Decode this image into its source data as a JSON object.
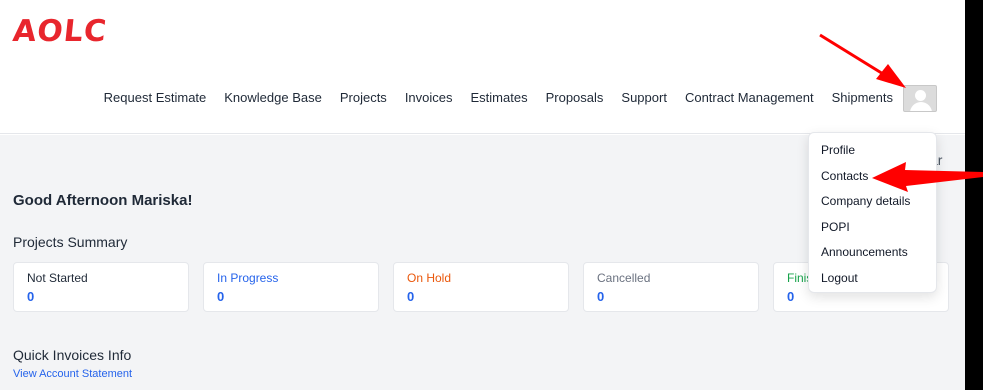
{
  "brand": {
    "logo_text": "AOLC",
    "color": "#e8262d"
  },
  "nav": {
    "items": [
      {
        "label": "Request Estimate"
      },
      {
        "label": "Knowledge Base"
      },
      {
        "label": "Projects"
      },
      {
        "label": "Invoices"
      },
      {
        "label": "Estimates"
      },
      {
        "label": "Proposals"
      },
      {
        "label": "Support"
      },
      {
        "label": "Contract Management"
      },
      {
        "label": "Shipments"
      }
    ],
    "avatar_icon": "user-avatar-icon"
  },
  "main": {
    "greeting": "Good Afternoon Mariska!",
    "partial_right_text": "ar",
    "projects_summary_title": "Projects Summary",
    "cards": [
      {
        "label": "Not Started",
        "value": "0",
        "label_color": "#1f2937"
      },
      {
        "label": "In Progress",
        "value": "0",
        "label_color": "#2563eb"
      },
      {
        "label": "On Hold",
        "value": "0",
        "label_color": "#ea580c"
      },
      {
        "label": "Cancelled",
        "value": "0",
        "label_color": "#6b7280"
      },
      {
        "label": "Finis",
        "value": "0",
        "label_color": "#16a34a"
      }
    ],
    "quick_invoices_title": "Quick Invoices Info",
    "view_account_statement": "View Account Statement"
  },
  "dropdown": {
    "items": [
      {
        "label": "Profile"
      },
      {
        "label": "Contacts"
      },
      {
        "label": "Company details"
      },
      {
        "label": "POPI"
      },
      {
        "label": "Announcements"
      },
      {
        "label": "Logout"
      }
    ]
  },
  "annotation_color": "#ff0000"
}
